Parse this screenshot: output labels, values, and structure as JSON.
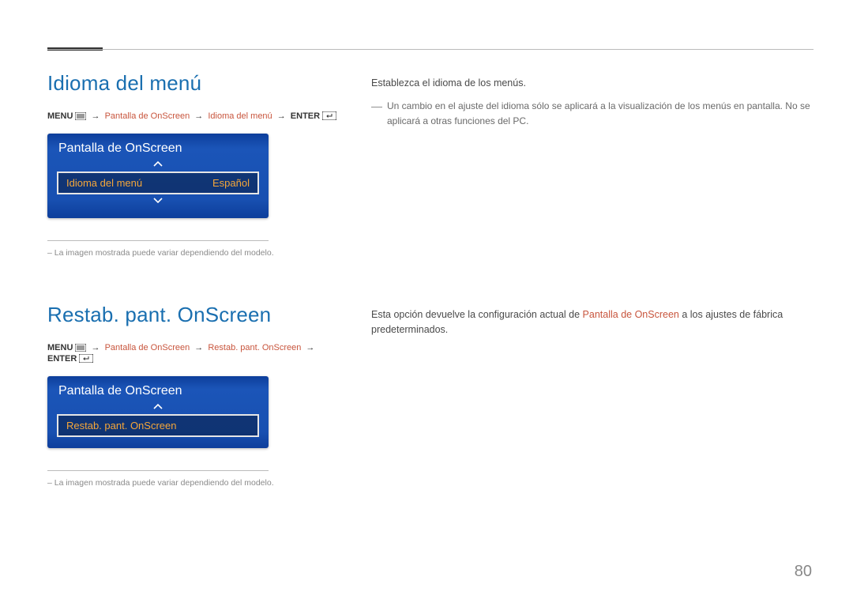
{
  "section1": {
    "title": "Idioma del menú",
    "breadcrumb": {
      "menu_label": "MENU",
      "items": [
        "Pantalla de OnScreen",
        "Idioma del menú"
      ],
      "enter_label": "ENTER"
    },
    "osd": {
      "panel_title": "Pantalla de OnScreen",
      "row_label": "Idioma del menú",
      "row_value": "Español"
    },
    "footnote": "–  La imagen mostrada puede variar dependiendo del modelo.",
    "desc": "Establezca el idioma de los menús.",
    "note": "Un cambio en el ajuste del idioma sólo se aplicará a la visualización de los menús en pantalla. No se aplicará a otras funciones del PC."
  },
  "section2": {
    "title": "Restab. pant. OnScreen",
    "breadcrumb": {
      "menu_label": "MENU",
      "items": [
        "Pantalla de OnScreen",
        "Restab. pant. OnScreen"
      ],
      "enter_label": "ENTER"
    },
    "osd": {
      "panel_title": "Pantalla de OnScreen",
      "row_label": "Restab. pant. OnScreen",
      "row_value": ""
    },
    "footnote": "–  La imagen mostrada puede variar dependiendo del modelo.",
    "desc_pre": "Esta opción devuelve la configuración actual de ",
    "desc_highlight": "Pantalla de OnScreen",
    "desc_post": " a los ajustes de fábrica predeterminados."
  },
  "page_number": "80"
}
